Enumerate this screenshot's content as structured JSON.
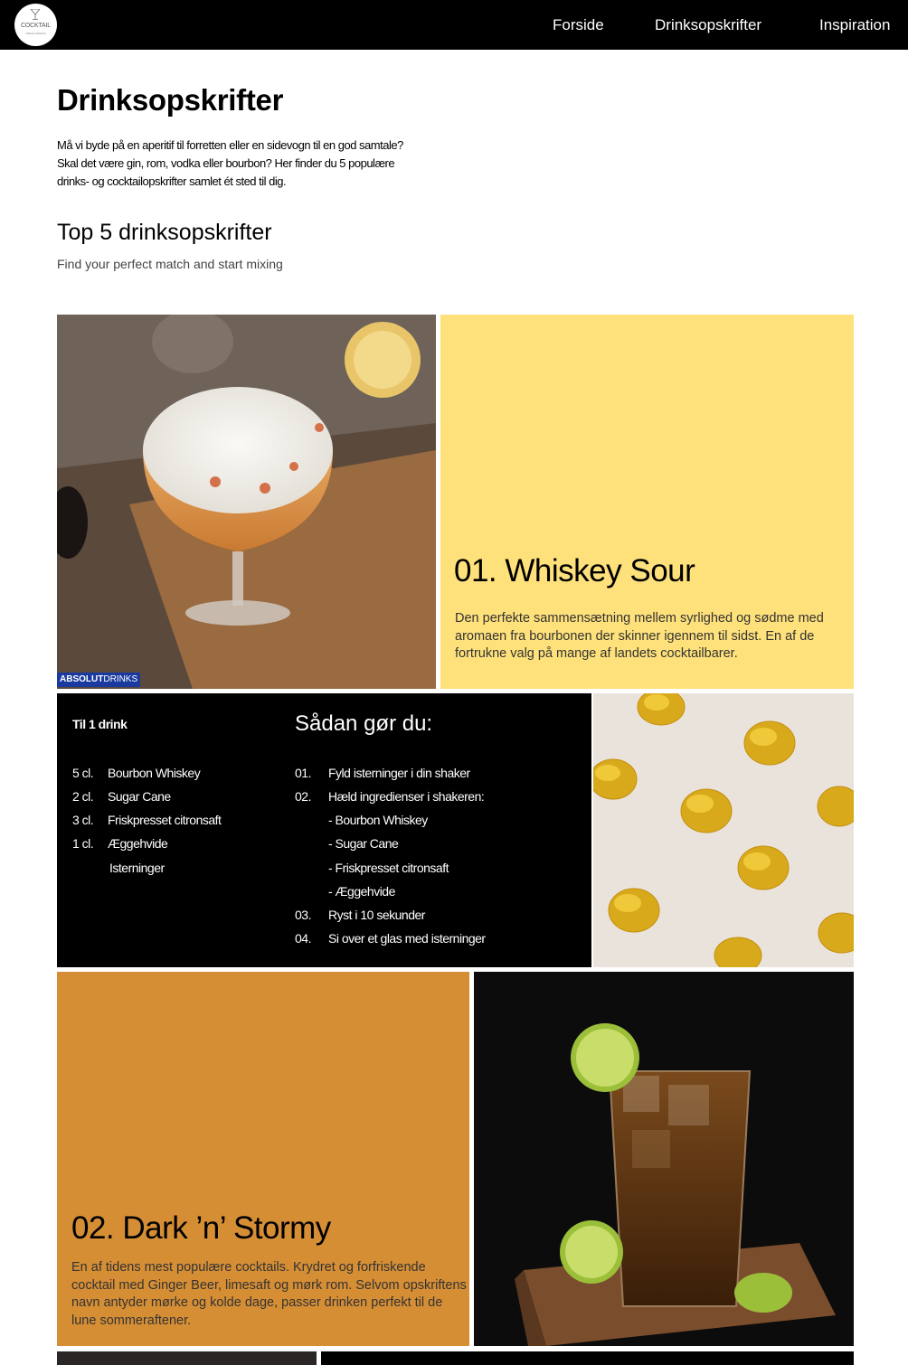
{
  "nav": {
    "logo_text": "COCKTAIL",
    "logo_sub": "FRESH DRINKS",
    "links": [
      "Forside",
      "Drinksopskrifter",
      "Inspiration"
    ]
  },
  "intro": {
    "title": "Drinksopskrifter",
    "text": "Må vi byde på en aperitif til forretten eller en sidevogn til en god samtale? Skal det være gin, rom, vodka eller bourbon? Her finder du 5 populære drinks- og cocktailopskrifter samlet ét sted til dig.",
    "section_title": "Top 5 drinksopskrifter",
    "section_sub": "Find your perfect match and start mixing"
  },
  "drink1": {
    "badge_a": "ABSOLUT",
    "badge_b": "DRINKS",
    "title": "01. Whiskey Sour",
    "desc": "Den perfekte sammensætning mellem syrlighed og sødme med aromaen fra bourbonen der skinner igennem til sidst. En af de fortrukne valg på mange af landets cocktailbarer."
  },
  "recipe": {
    "ing_heading": "Til 1 drink",
    "steps_heading": "Sådan gør du:",
    "ingredients": [
      {
        "amount": "5 cl.",
        "name": "Bourbon Whiskey"
      },
      {
        "amount": "2 cl.",
        "name": "Sugar Cane"
      },
      {
        "amount": "3 cl.",
        "name": "Friskpresset citronsaft"
      },
      {
        "amount": "1 cl.",
        "name": "Æggehvide"
      },
      {
        "amount": "",
        "name": "Isterninger"
      }
    ],
    "steps": [
      {
        "num": "01.",
        "text": "Fyld isterninger i din shaker"
      },
      {
        "num": "02.",
        "text": "Hæld ingredienser i shakeren:"
      },
      {
        "num": "03.",
        "text": "Ryst i 10 sekunder"
      },
      {
        "num": "04.",
        "text": "Si over et glas med isterninger"
      }
    ],
    "sub_steps": [
      "- Bourbon Whiskey",
      "- Sugar Cane",
      "- Friskpresset citronsaft",
      "- Æggehvide"
    ]
  },
  "drink2": {
    "title": "02. Dark ’n’ Stormy",
    "desc": "En af tidens mest populære cocktails. Krydret og forfriskende cocktail med Ginger Beer, limesaft og mørk rom. Selvom opskriftens navn antyder mørke og kolde dage, passer drinken perfekt til de lune sommeraftener."
  },
  "colors": {
    "nav_bg": "#000000",
    "yellow_card": "#ffe17b",
    "orange_card": "#d68e35",
    "recipe_bg": "#000000"
  }
}
